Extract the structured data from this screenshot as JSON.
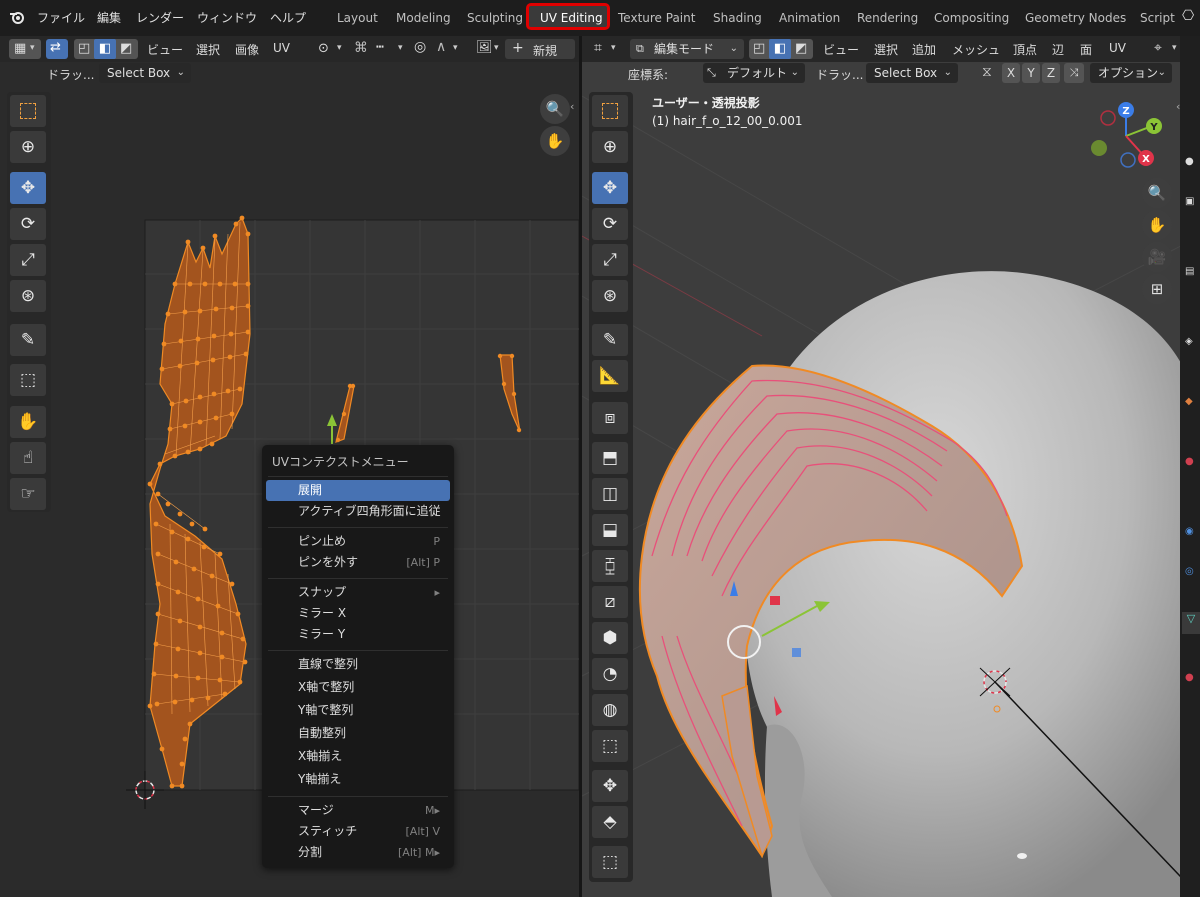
{
  "topbar": {
    "logo": "blender-logo",
    "menus": [
      "ファイル",
      "編集",
      "レンダー",
      "ウィンドウ",
      "ヘルプ"
    ],
    "workspaces": [
      "Layout",
      "Modeling",
      "Sculpting",
      "UV Editing",
      "Texture Paint",
      "Shading",
      "Animation",
      "Rendering",
      "Compositing",
      "Geometry Nodes",
      "Script"
    ],
    "active_workspace": "UV Editing"
  },
  "uv_editor": {
    "header_menus": [
      "ビュー",
      "選択",
      "画像",
      "UV"
    ],
    "new_button": "新規",
    "new_plus": "+",
    "drag_label": "ドラッ...",
    "select_box": "Select Box",
    "tools": [
      "select-box-icon",
      "cursor-icon",
      "move-icon",
      "rotate-icon",
      "scale-icon",
      "transform-icon",
      "annotate-icon",
      "rip-icon",
      "grab-icon",
      "relax-icon",
      "pinch-icon"
    ]
  },
  "context_menu": {
    "title": "UVコンテクストメニュー",
    "groups": [
      [
        {
          "label": "展開",
          "shortcut": "",
          "highlighted": true
        },
        {
          "label": "アクティブ四角形面に追従",
          "shortcut": ""
        }
      ],
      [
        {
          "label": "ピン止め",
          "shortcut": "P"
        },
        {
          "label": "ピンを外す",
          "shortcut": "[Alt] P"
        }
      ],
      [
        {
          "label": "スナップ",
          "shortcut": "▸"
        },
        {
          "label": "ミラー X",
          "shortcut": ""
        },
        {
          "label": "ミラー Y",
          "shortcut": ""
        }
      ],
      [
        {
          "label": "直線で整列",
          "shortcut": ""
        },
        {
          "label": "X軸で整列",
          "shortcut": ""
        },
        {
          "label": "Y軸で整列",
          "shortcut": ""
        },
        {
          "label": "自動整列",
          "shortcut": ""
        },
        {
          "label": "X軸揃え",
          "shortcut": ""
        },
        {
          "label": "Y軸揃え",
          "shortcut": ""
        }
      ],
      [
        {
          "label": "マージ",
          "shortcut": "M▸"
        },
        {
          "label": "スティッチ",
          "shortcut": "[Alt] V"
        },
        {
          "label": "分割",
          "shortcut": "[Alt] M▸"
        }
      ]
    ]
  },
  "viewport": {
    "mode": "編集モード",
    "header_menus": [
      "ビュー",
      "選択",
      "追加",
      "メッシュ",
      "頂点",
      "辺",
      "面",
      "UV"
    ],
    "coord_label": "座標系:",
    "coord_value": "デフォルト",
    "drag_label": "ドラッ...",
    "select_box": "Select Box",
    "axes": [
      "X",
      "Y",
      "Z"
    ],
    "options": "オプション",
    "view_title": "ユーザー・透視投影",
    "object_name": "(1) hair_f_o_12_00_0.001",
    "gizmo": {
      "z": "Z",
      "y": "Y",
      "x": "X"
    },
    "colors": {
      "x": "#e0344a",
      "y": "#8bc436",
      "z": "#3b7de8",
      "orange": "#f08a24"
    }
  }
}
